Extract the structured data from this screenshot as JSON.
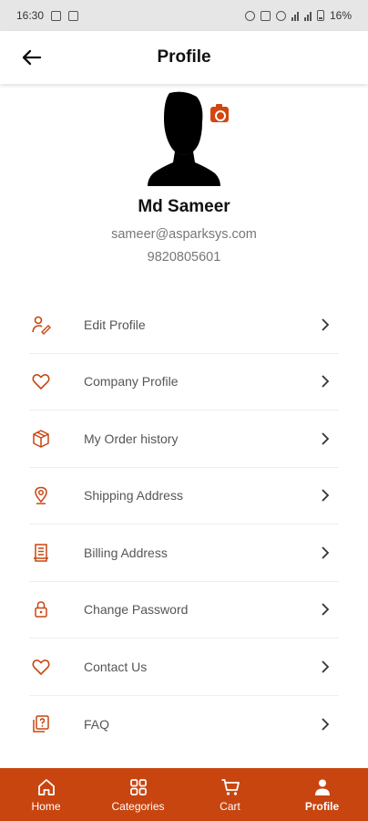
{
  "status_bar": {
    "time": "16:30",
    "battery": "16%"
  },
  "header": {
    "title": "Profile",
    "back_icon": "arrow-left-icon"
  },
  "profile": {
    "name": "Md Sameer",
    "email": "sameer@asparksys.com",
    "phone": "9820805601",
    "camera_icon": "camera-icon"
  },
  "menu": [
    {
      "label": "Edit Profile",
      "icon": "user-edit-icon"
    },
    {
      "label": "Company Profile",
      "icon": "heart-icon"
    },
    {
      "label": "My Order history",
      "icon": "box-icon"
    },
    {
      "label": "Shipping Address",
      "icon": "location-pin-icon"
    },
    {
      "label": "Billing Address",
      "icon": "receipt-icon"
    },
    {
      "label": "Change Password",
      "icon": "lock-icon"
    },
    {
      "label": "Contact Us",
      "icon": "heart-icon"
    },
    {
      "label": "FAQ",
      "icon": "question-icon"
    }
  ],
  "bottom_nav": [
    {
      "label": "Home",
      "icon": "home-icon"
    },
    {
      "label": "Categories",
      "icon": "grid-icon"
    },
    {
      "label": "Cart",
      "icon": "cart-icon"
    },
    {
      "label": "Profile",
      "icon": "person-icon",
      "active": true
    }
  ],
  "colors": {
    "accent": "#c84510",
    "text_muted": "#777777",
    "status_bar_bg": "#e6e6e6"
  }
}
